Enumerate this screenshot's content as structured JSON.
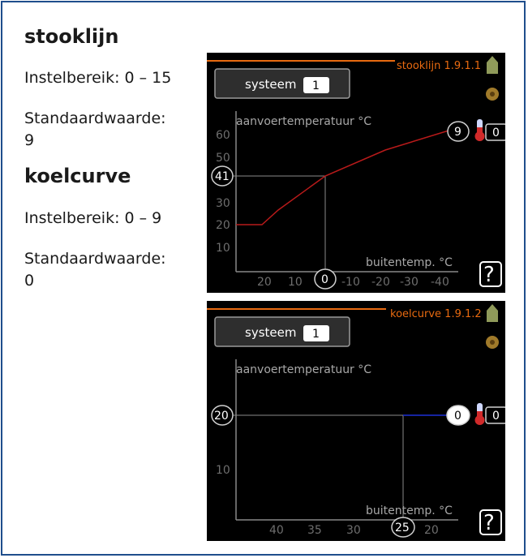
{
  "left": {
    "heading_1": "stooklijn",
    "range_1": "Instelbereik: 0 – 15",
    "default_label_1": "Standaardwaarde:",
    "default_value_1": "9",
    "heading_2": "koelcurve",
    "range_2": "Instelbereik: 0 – 9",
    "default_label_2": "Standaardwaarde:",
    "default_value_2": "0"
  },
  "screens": [
    {
      "menu_title": "stooklijn 1.9.1.1",
      "system_label": "systeem",
      "system_value": "1",
      "y_axis_label": "aanvoertemperatuur °C",
      "x_axis_label": "buitentemp. °C",
      "y_ticks": [
        "60",
        "50",
        "40",
        "30",
        "20",
        "10"
      ],
      "x_ticks": [
        "20",
        "10",
        "0",
        "-10",
        "-20",
        "-30",
        "-40"
      ],
      "curve_value": "9",
      "temp_offset": "0",
      "marker_y": "41",
      "marker_x": "0",
      "help_label": "?"
    },
    {
      "menu_title": "koelcurve 1.9.1.2",
      "system_label": "systeem",
      "system_value": "1",
      "y_axis_label": "aanvoertemperatuur °C",
      "x_axis_label": "buitentemp. °C",
      "y_ticks": [
        "20",
        "10"
      ],
      "x_ticks": [
        "40",
        "35",
        "30",
        "25",
        "20"
      ],
      "curve_value": "0",
      "temp_offset": "0",
      "marker_y": "20",
      "marker_x": "25",
      "help_label": "?"
    }
  ],
  "colors": {
    "border": "#1f4e8c",
    "menu_title": "#e86a10",
    "heat_curve": "#b81a1a",
    "cool_curve": "#1a2ab8",
    "grid": "#888888",
    "screen_bg": "#000000"
  }
}
